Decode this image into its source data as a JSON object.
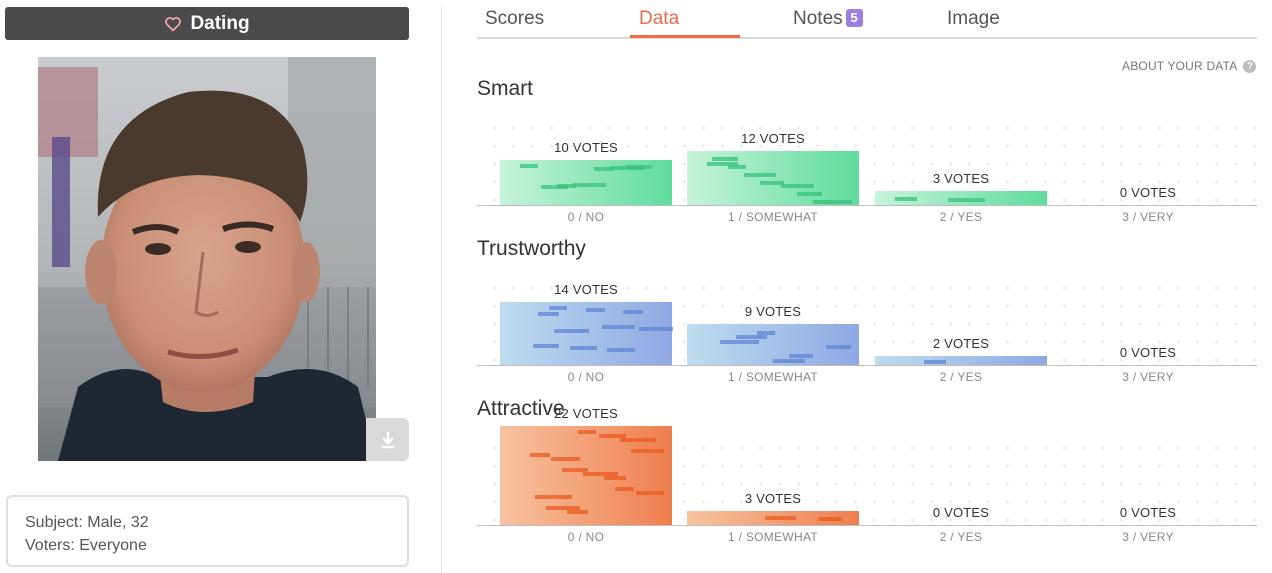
{
  "category": {
    "label": "Dating",
    "icon": "heart-icon"
  },
  "subject": {
    "subject_line": "Subject: Male, 32",
    "voters_line": "Voters: Everyone"
  },
  "tabs": [
    {
      "label": "Scores",
      "active": false
    },
    {
      "label": "Data",
      "active": true
    },
    {
      "label": "Notes",
      "active": false,
      "badge": "5"
    },
    {
      "label": "Image",
      "active": false
    }
  ],
  "about_link": "ABOUT YOUR DATA",
  "colors": {
    "accent": "#ef6b4a",
    "smart": "#5fdc9b",
    "trustworthy": "#8fa8e3",
    "attractive": "#ef7e4e",
    "category_bar": "#4a4a4a",
    "badge": "#9b7ee0"
  },
  "sections": [
    {
      "title": "Smart",
      "categories": [
        "0 / NO",
        "1 / SOMEWHAT",
        "2 / YES",
        "3 / VERY"
      ],
      "vote_labels": [
        "10 VOTES",
        "12 VOTES",
        "3 VOTES",
        "0 VOTES"
      ],
      "votes": [
        10,
        12,
        3,
        0
      ]
    },
    {
      "title": "Trustworthy",
      "categories": [
        "0 / NO",
        "1 / SOMEWHAT",
        "2 / YES",
        "3 / VERY"
      ],
      "vote_labels": [
        "14 VOTES",
        "9 VOTES",
        "2 VOTES",
        "0 VOTES"
      ],
      "votes": [
        14,
        9,
        2,
        0
      ]
    },
    {
      "title": "Attractive",
      "categories": [
        "0 / NO",
        "1 / SOMEWHAT",
        "2 / YES",
        "3 / VERY"
      ],
      "vote_labels": [
        "22 VOTES",
        "3 VOTES",
        "0 VOTES",
        "0 VOTES"
      ],
      "votes": [
        22,
        3,
        0,
        0
      ]
    }
  ]
}
